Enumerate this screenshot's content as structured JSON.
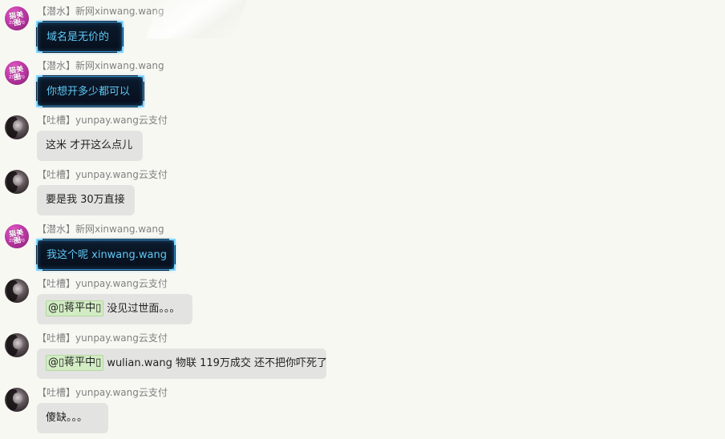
{
  "messages": [
    {
      "sender": "【潜水】新网xinwang.wang",
      "avatar": "pink",
      "style": "dark",
      "mention": "",
      "text": "域名是无价的",
      "width": 107
    },
    {
      "sender": "【潜水】新网xinwang.wang",
      "avatar": "pink",
      "style": "dark",
      "mention": "",
      "text": "你想开多少都可以",
      "width": 133
    },
    {
      "sender": "【吐槽】yunpay.wang云支付",
      "avatar": "dark",
      "style": "gray",
      "mention": "",
      "text": "这米 才开这么点儿",
      "width": 132
    },
    {
      "sender": "【吐槽】yunpay.wang云支付",
      "avatar": "dark",
      "style": "gray",
      "mention": "",
      "text": "要是我 30万直接",
      "width": 122
    },
    {
      "sender": "【潜水】新网xinwang.wang",
      "avatar": "pink",
      "style": "dark",
      "mention": "",
      "text": "我这个呢 xinwang.wang",
      "width": 172
    },
    {
      "sender": "【吐槽】yunpay.wang云支付",
      "avatar": "dark",
      "style": "gray",
      "mention": "@\u0000蒋平中\u0000",
      "text": "没见过世面。。。",
      "width": 194
    },
    {
      "sender": "【吐槽】yunpay.wang云支付",
      "avatar": "dark",
      "style": "gray",
      "mention": "@\u0000蒋平中\u0000",
      "text": "wulian.wang 物联  119万成交 还不把你吓死了",
      "width": 361
    },
    {
      "sender": "【吐槽】yunpay.wang云支付",
      "avatar": "dark",
      "style": "gray",
      "mention": "",
      "text": "傻缺。。。",
      "width": 89
    }
  ],
  "avatar_logo": {
    "line1": "猫美图",
    "line2": "ZC4770"
  },
  "colors": {
    "background": "#f8f8f3",
    "gray_bubble": "#e3e3e1",
    "dark_bubble": "#0c1a2c",
    "dark_bubble_text": "#5fc8f4",
    "mention_bg": "#d2ecc4",
    "sender_text": "#808080"
  }
}
